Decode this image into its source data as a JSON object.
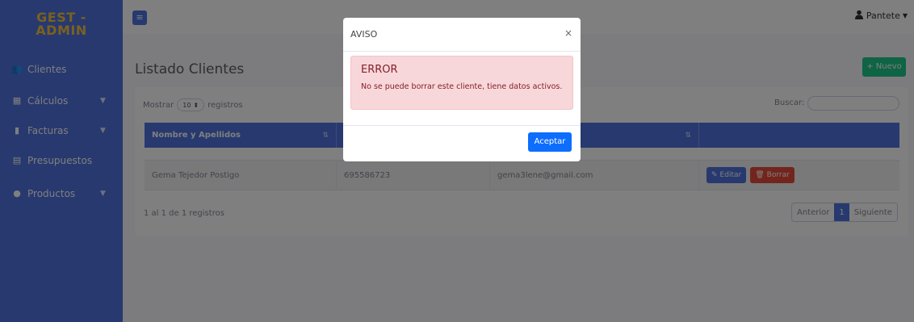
{
  "sidebar": {
    "brand_line1": "GEST -",
    "brand_line2": "ADMIN",
    "items": [
      {
        "label": "Clientes",
        "icon": "users-icon"
      },
      {
        "label": "Cálculos",
        "icon": "calculator-icon"
      },
      {
        "label": "Facturas",
        "icon": "file-icon"
      },
      {
        "label": "Presupuestos",
        "icon": "document-icon"
      },
      {
        "label": "Productos",
        "icon": "product-icon"
      }
    ]
  },
  "topbar": {
    "user_name": "Pantete"
  },
  "main": {
    "title": "Listado Clientes",
    "new_button": "+ Nuevo",
    "show_prefix": "Mostrar",
    "show_value": "10",
    "show_suffix": "registros",
    "search_label": "Buscar:",
    "columns": [
      "Nombre y Apellidos",
      "",
      "",
      ""
    ],
    "rows": [
      {
        "name": "Gema Tejedor Postigo",
        "phone": "695586723",
        "email": "gema3lene@gmail.com"
      }
    ],
    "edit_label": "Editar",
    "delete_label": "Borrar",
    "info": "1 al 1 de 1 registros",
    "pager": {
      "prev": "Anterior",
      "page": "1",
      "next": "Siguiente"
    }
  },
  "modal": {
    "title": "AVISO",
    "close": "×",
    "alert_title": "ERROR",
    "alert_message": "No se puede borrar este cliente, tiene datos activos.",
    "accept": "Aceptar"
  },
  "colors": {
    "sidebar": "#4e73df",
    "brand": "#f6c23e",
    "success": "#1cc88a",
    "danger": "#e74a3b",
    "alert_bg": "#f8d7da",
    "primary_button": "#0d6efd"
  }
}
